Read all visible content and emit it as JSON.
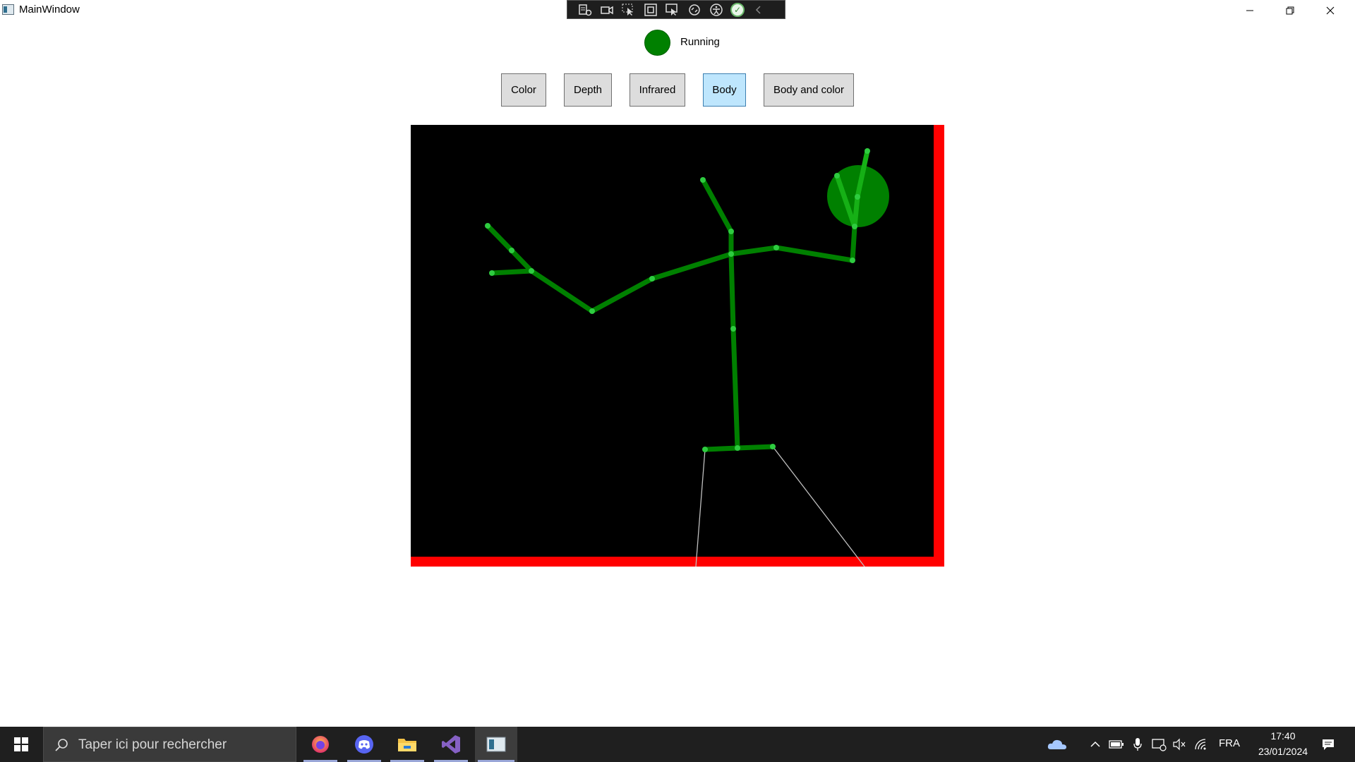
{
  "window": {
    "title": "MainWindow"
  },
  "status": {
    "label": "Running",
    "color": "#008000"
  },
  "modes": {
    "color": "Color",
    "depth": "Depth",
    "infrared": "Infrared",
    "body": "Body",
    "body_and_color": "Body and color",
    "active": "Body"
  },
  "viewer": {
    "background": "#000000",
    "edge_clip_color": "#ff0000",
    "bone_color": "#008000",
    "joint_color": "#2ecc40",
    "head_circle_color": "#008000",
    "inferred_bone_color": "#c0c0c0"
  },
  "taskbar": {
    "search_placeholder": "Taper ici pour rechercher",
    "apps": [
      "firefox-icon",
      "discord-icon",
      "file-explorer-icon",
      "visual-studio-icon",
      "wpf-app-icon"
    ],
    "language": "FRA",
    "time": "17:40",
    "date": "23/01/2024"
  }
}
